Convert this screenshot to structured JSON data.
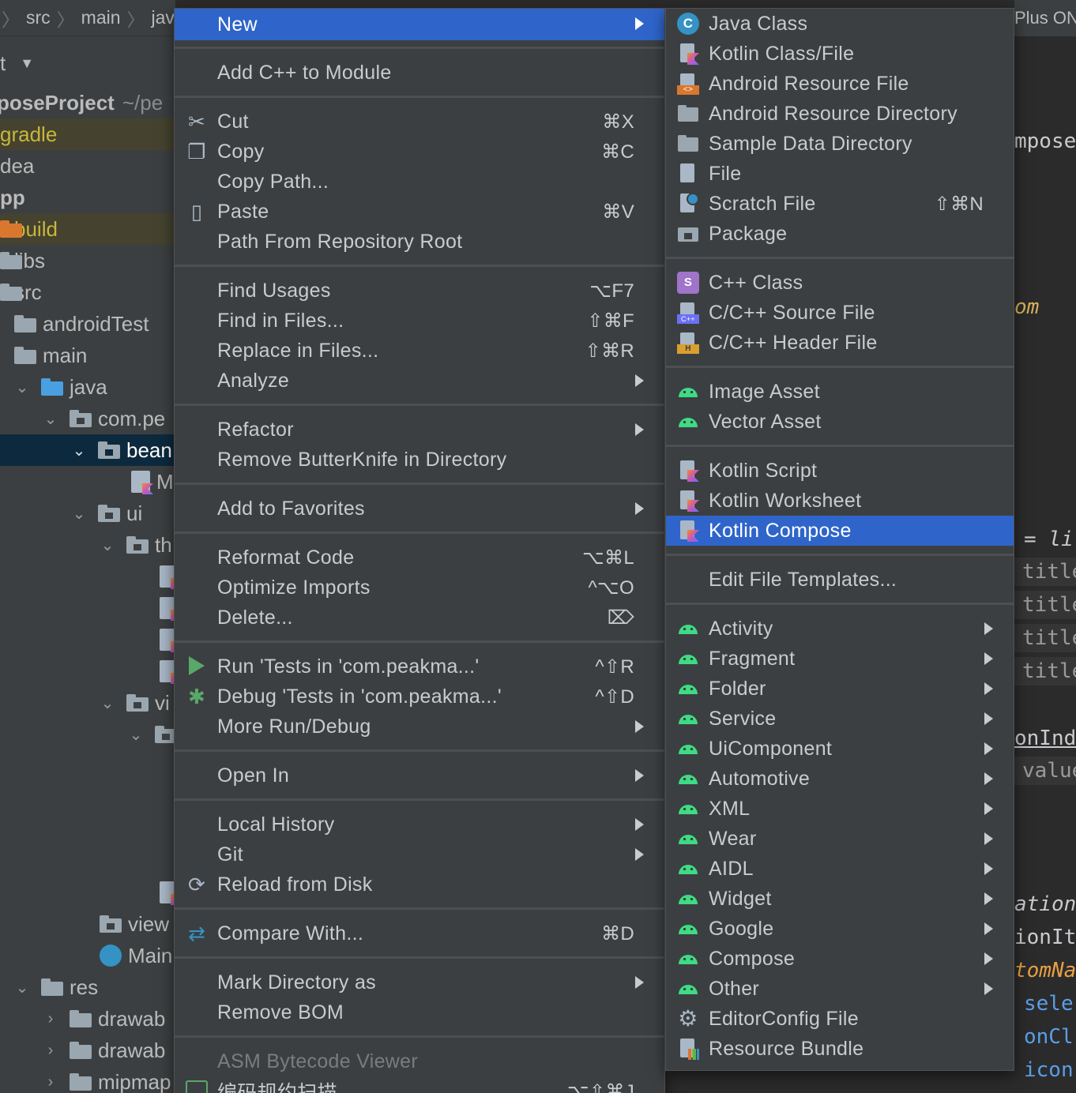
{
  "breadcrumbs": [
    "src",
    "main",
    "java"
  ],
  "project_header": "t",
  "tree": [
    {
      "label": "poseProject",
      "suffix": "~/pe",
      "y": 0
    },
    {
      "label": "gradle"
    },
    {
      "label": "dea"
    },
    {
      "label": "pp"
    },
    {
      "label": "build"
    },
    {
      "label": "libs"
    },
    {
      "label": "src"
    },
    {
      "label": "androidTest"
    },
    {
      "label": "main"
    },
    {
      "label": "java"
    },
    {
      "label": "com.pe"
    },
    {
      "label": "bean"
    },
    {
      "label": "M"
    },
    {
      "label": "ui"
    },
    {
      "label": "th"
    },
    {
      "label": "vi"
    },
    {
      "label": "view"
    },
    {
      "label": "Main"
    },
    {
      "label": "res"
    },
    {
      "label": "drawab"
    },
    {
      "label": "drawab"
    },
    {
      "label": "mipmap"
    }
  ],
  "editor": {
    "tab": "Plus ONE",
    "lines": [
      "mpose",
      "om",
      "= li",
      "title:",
      "title:",
      "title:",
      "title:",
      "onInd",
      "value",
      "ation",
      "ionIt",
      "tomNa",
      "sele",
      "onCl",
      "icon"
    ]
  },
  "main_menu": {
    "new": "New",
    "add_cpp": "Add C++ to Module",
    "cut": "Cut",
    "cut_sc": "⌘X",
    "copy": "Copy",
    "copy_sc": "⌘C",
    "copy_path": "Copy Path...",
    "paste": "Paste",
    "paste_sc": "⌘V",
    "path_repo": "Path From Repository Root",
    "find_usages": "Find Usages",
    "find_usages_sc": "⌥F7",
    "find_files": "Find in Files...",
    "find_files_sc": "⇧⌘F",
    "replace_files": "Replace in Files...",
    "replace_files_sc": "⇧⌘R",
    "analyze": "Analyze",
    "refactor": "Refactor",
    "remove_butterknife": "Remove ButterKnife in Directory",
    "add_favorites": "Add to Favorites",
    "reformat": "Reformat Code",
    "reformat_sc": "⌥⌘L",
    "optimize": "Optimize Imports",
    "optimize_sc": "^⌥O",
    "delete": "Delete...",
    "delete_sc": "⌦",
    "run_tests": "Run 'Tests in 'com.peakma...'",
    "run_tests_sc": "^⇧R",
    "debug_tests": "Debug 'Tests in 'com.peakma...'",
    "debug_tests_sc": "^⇧D",
    "more_run": "More Run/Debug",
    "open_in": "Open In",
    "local_history": "Local History",
    "git": "Git",
    "reload": "Reload from Disk",
    "compare": "Compare With...",
    "compare_sc": "⌘D",
    "mark_dir": "Mark Directory as",
    "remove_bom": "Remove BOM",
    "asm": "ASM Bytecode Viewer",
    "scan": "编码规约扫描",
    "scan_sc": "⌥⇧⌘J"
  },
  "sub_menu": {
    "java_class": "Java Class",
    "kotlin_class": "Kotlin Class/File",
    "android_res_file": "Android Resource File",
    "android_res_dir": "Android Resource Directory",
    "sample_data_dir": "Sample Data Directory",
    "file": "File",
    "scratch": "Scratch File",
    "scratch_sc": "⇧⌘N",
    "package": "Package",
    "cpp_class": "C++ Class",
    "cpp_source": "C/C++ Source File",
    "cpp_header": "C/C++ Header File",
    "image_asset": "Image Asset",
    "vector_asset": "Vector Asset",
    "kotlin_script": "Kotlin Script",
    "kotlin_worksheet": "Kotlin Worksheet",
    "kotlin_compose": "Kotlin Compose",
    "edit_templates": "Edit File Templates...",
    "activity": "Activity",
    "fragment": "Fragment",
    "folder": "Folder",
    "service": "Service",
    "uicomponent": "UiComponent",
    "automotive": "Automotive",
    "xml": "XML",
    "wear": "Wear",
    "aidl": "AIDL",
    "widget": "Widget",
    "google": "Google",
    "compose": "Compose",
    "other": "Other",
    "editorconfig": "EditorConfig File",
    "resource_bundle": "Resource Bundle"
  },
  "colors": {
    "highlight": "#2f65ca",
    "menu_bg": "#3c3f41",
    "android_green": "#3ddc84",
    "run_green": "#59a869"
  },
  "icons": {
    "java_class": "java-class-icon",
    "kotlin": "kotlin-file-icon",
    "android": "android-icon",
    "folder": "folder-icon",
    "scissors": "cut-icon",
    "copy": "copy-icon",
    "paste": "clipboard-icon",
    "run": "run-icon",
    "debug": "debug-icon",
    "reload": "reload-icon",
    "compare": "compare-icon",
    "gear": "gear-icon"
  }
}
